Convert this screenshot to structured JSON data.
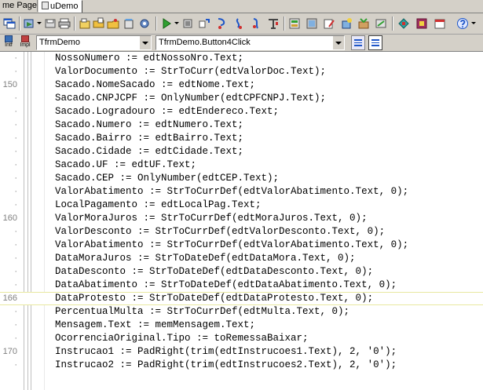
{
  "tabs": [
    {
      "label": "me Page"
    },
    {
      "label": "uDemo"
    }
  ],
  "combos": {
    "class_combo": "TfrmDemo",
    "method_combo": "TfrmDemo.Button4Click"
  },
  "small_buttons": {
    "intf_label": "Intf",
    "impl_label": "Impl"
  },
  "toolbar_icons": [
    "cascade-windows-icon",
    "open-project-icon",
    "save-icon",
    "print-icon",
    "cut-icon",
    "copy-icon",
    "paste-icon",
    "delete-icon",
    "component-icon",
    "run-icon",
    "stop-icon",
    "step-icon",
    "trace-icon",
    "breakpoint-icon",
    "watch-icon",
    "evaluate-icon",
    "calendar-icon",
    "form-icon",
    "unit-icon",
    "edit-icon",
    "wizard-icon",
    "package-icon",
    "tools-icon",
    "database-icon",
    "help-icon"
  ],
  "editor": {
    "lines": [
      {
        "gutter": "·",
        "text": "NossoNumero := edtNossoNro.Text;"
      },
      {
        "gutter": "·",
        "text": "ValorDocumento := StrToCurr(edtValorDoc.Text);"
      },
      {
        "gutter": "150",
        "text": "Sacado.NomeSacado := edtNome.Text;"
      },
      {
        "gutter": "·",
        "text": "Sacado.CNPJCPF := OnlyNumber(edtCPFCNPJ.Text);"
      },
      {
        "gutter": "·",
        "text": "Sacado.Logradouro := edtEndereco.Text;"
      },
      {
        "gutter": "·",
        "text": "Sacado.Numero := edtNumero.Text;"
      },
      {
        "gutter": "·",
        "text": "Sacado.Bairro := edtBairro.Text;"
      },
      {
        "gutter": "·",
        "text": "Sacado.Cidade := edtCidade.Text;"
      },
      {
        "gutter": "·",
        "text": "Sacado.UF := edtUF.Text;"
      },
      {
        "gutter": "·",
        "text": "Sacado.CEP := OnlyNumber(edtCEP.Text);"
      },
      {
        "gutter": "·",
        "text": "ValorAbatimento := StrToCurrDef(edtValorAbatimento.Text, 0);"
      },
      {
        "gutter": "·",
        "text": "LocalPagamento := edtLocalPag.Text;"
      },
      {
        "gutter": "160",
        "text": "ValorMoraJuros := StrToCurrDef(edtMoraJuros.Text, 0);"
      },
      {
        "gutter": "·",
        "text": "ValorDesconto := StrToCurrDef(edtValorDesconto.Text, 0);"
      },
      {
        "gutter": "·",
        "text": "ValorAbatimento := StrToCurrDef(edtValorAbatimento.Text, 0);"
      },
      {
        "gutter": "·",
        "text": "DataMoraJuros := StrToDateDef(edtDataMora.Text, 0);"
      },
      {
        "gutter": "·",
        "text": "DataDesconto := StrToDateDef(edtDataDesconto.Text, 0);"
      },
      {
        "gutter": "·",
        "text": "DataAbatimento := StrToDateDef(edtDataAbatimento.Text, 0);"
      },
      {
        "gutter": "166",
        "text": "DataProtesto := StrToDateDef(edtDataProtesto.Text, 0);"
      },
      {
        "gutter": "·",
        "text": "PercentualMulta := StrToCurrDef(edtMulta.Text, 0);"
      },
      {
        "gutter": "·",
        "text": "Mensagem.Text := memMensagem.Text;"
      },
      {
        "gutter": "·",
        "text": "OcorrenciaOriginal.Tipo := toRemessaBaixar;"
      },
      {
        "gutter": "170",
        "text": "Instrucao1 := PadRight(trim(edtInstrucoes1.Text), 2, '0');"
      },
      {
        "gutter": "·",
        "text": "Instrucao2 := PadRight(trim(edtInstrucoes2.Text), 2, '0');"
      }
    ]
  }
}
